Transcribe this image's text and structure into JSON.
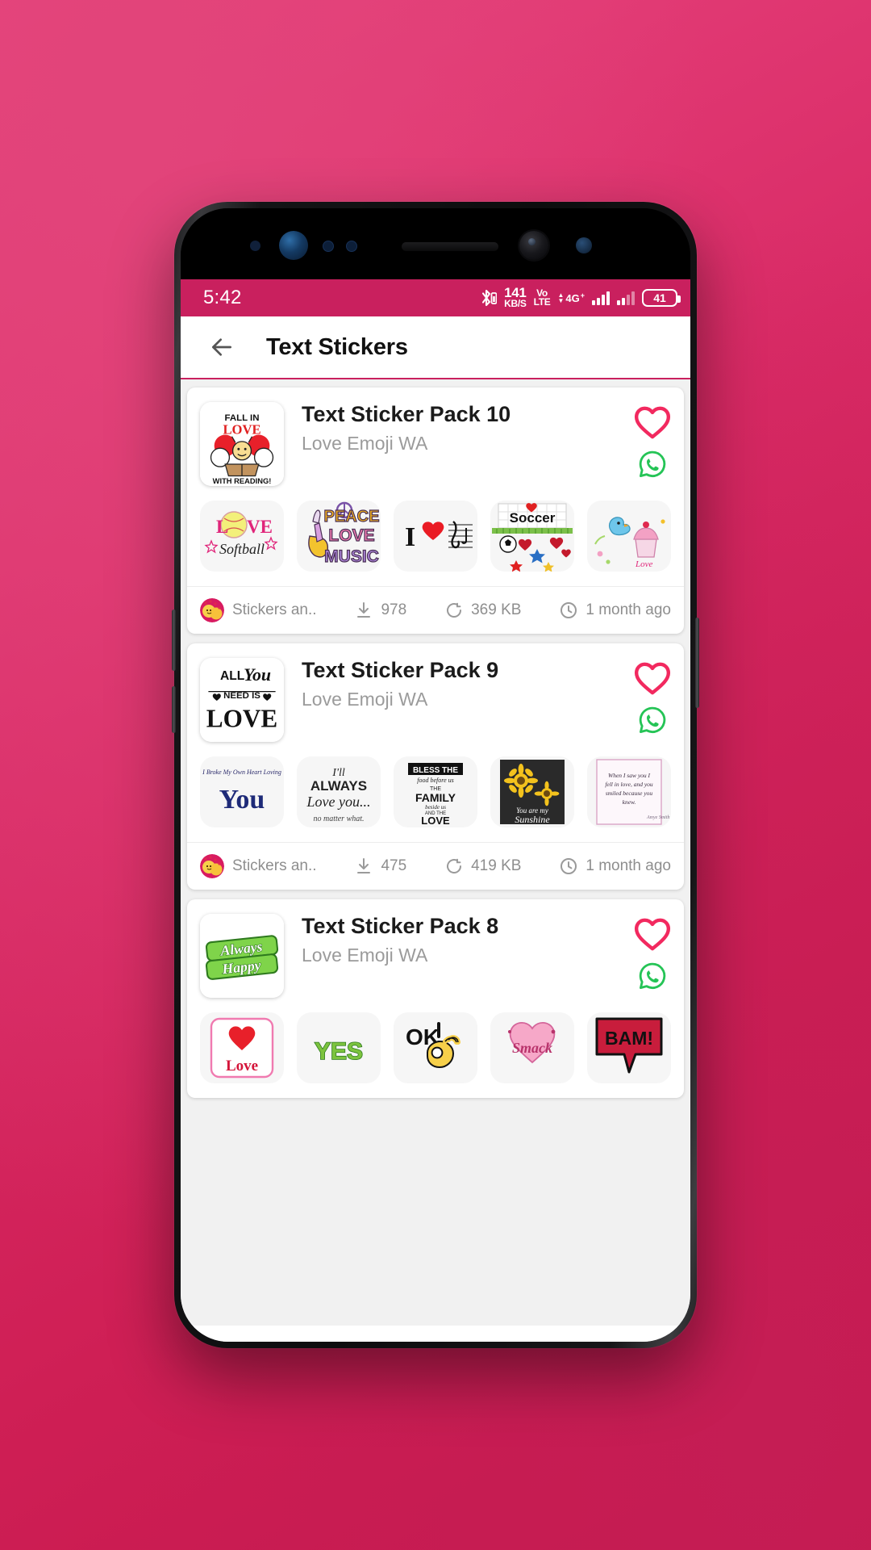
{
  "status_bar": {
    "clock": "5:42",
    "bluetooth_icon": "bluetooth-icon",
    "data_rate_value": "141",
    "data_rate_unit": "KB/S",
    "volte_top": "Vo",
    "volte_bottom": "LTE",
    "network_label": "4G",
    "network_sup": "+",
    "battery_level": "41",
    "background_color": "#c9205e"
  },
  "app_bar": {
    "back_icon": "back-arrow-icon",
    "title": "Text Stickers",
    "accent_color": "#c9205e"
  },
  "packs": [
    {
      "title": "Text Sticker Pack 10",
      "author": "Love Emoji WA",
      "favorite_icon": "heart-icon",
      "whatsapp_icon": "whatsapp-icon",
      "thumb_name": "fall-in-love-with-reading-thumb",
      "stickers": [
        "love-softball-sticker",
        "peace-love-music-sticker",
        "i-heart-music-sticker",
        "i-love-soccer-sticker",
        "bird-cupcake-love-sticker"
      ],
      "meta": {
        "source_label": "Stickers an..",
        "downloads": "978",
        "size": "369 KB",
        "updated": "1 month ago"
      }
    },
    {
      "title": "Text Sticker Pack 9",
      "author": "Love Emoji WA",
      "favorite_icon": "heart-icon",
      "whatsapp_icon": "whatsapp-icon",
      "thumb_name": "all-you-need-is-love-thumb",
      "stickers": [
        "i-broke-my-own-heart-you-sticker",
        "ill-always-love-you-sticker",
        "bless-the-family-love-sticker",
        "you-are-my-sunshine-sunflower-sticker",
        "when-i-saw-you-quote-sticker"
      ],
      "meta": {
        "source_label": "Stickers an..",
        "downloads": "475",
        "size": "419 KB",
        "updated": "1 month ago"
      }
    },
    {
      "title": "Text Sticker Pack 8",
      "author": "Love Emoji WA",
      "favorite_icon": "heart-icon",
      "whatsapp_icon": "whatsapp-icon",
      "thumb_name": "always-happy-thumb",
      "stickers": [
        "love-heart-sticker",
        "yes-sticker",
        "ok-hand-sticker",
        "smack-kiss-sticker",
        "bam-sticker"
      ],
      "meta": {
        "source_label": "Stickers an..",
        "downloads": "",
        "size": "",
        "updated": ""
      }
    }
  ]
}
